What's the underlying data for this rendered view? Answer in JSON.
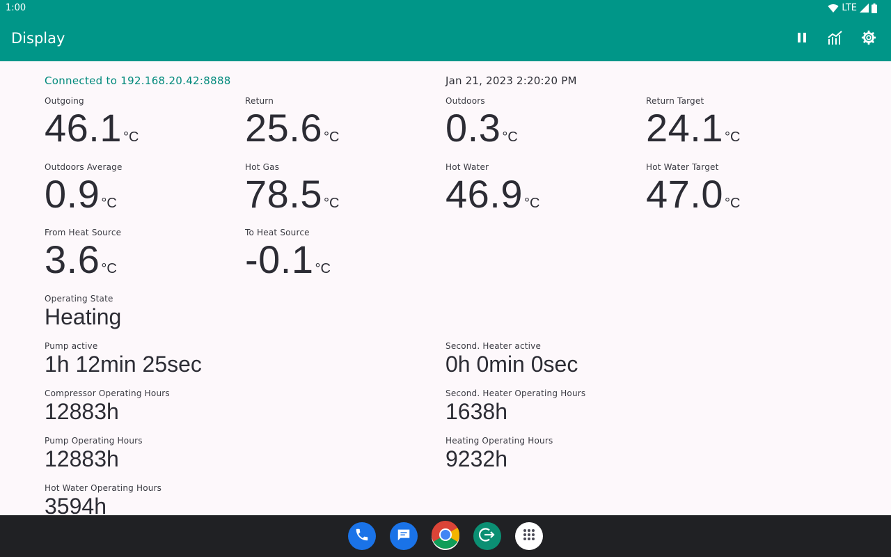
{
  "status_bar": {
    "time": "1:00",
    "network": "LTE"
  },
  "app_bar": {
    "title": "Display",
    "actions": {
      "pause": "pause-icon",
      "chart": "chart-icon",
      "settings": "gear-icon"
    }
  },
  "connection_status": "Connected to 192.168.20.42:8888",
  "timestamp": "Jan 21, 2023 2:20:20 PM",
  "temperatures": {
    "outgoing": {
      "label": "Outgoing",
      "value": "46.1",
      "unit": "°C"
    },
    "return": {
      "label": "Return",
      "value": "25.6",
      "unit": "°C"
    },
    "outdoors": {
      "label": "Outdoors",
      "value": "0.3",
      "unit": "°C"
    },
    "return_target": {
      "label": "Return Target",
      "value": "24.1",
      "unit": "°C"
    },
    "outdoors_average": {
      "label": "Outdoors Average",
      "value": "0.9",
      "unit": "°C"
    },
    "hot_gas": {
      "label": "Hot Gas",
      "value": "78.5",
      "unit": "°C"
    },
    "hot_water": {
      "label": "Hot Water",
      "value": "46.9",
      "unit": "°C"
    },
    "hot_water_target": {
      "label": "Hot Water Target",
      "value": "47.0",
      "unit": "°C"
    },
    "from_heat_source": {
      "label": "From Heat Source",
      "value": "3.6",
      "unit": "°C"
    },
    "to_heat_source": {
      "label": "To Heat Source",
      "value": "-0.1",
      "unit": "°C"
    }
  },
  "operating_state": {
    "label": "Operating State",
    "value": "Heating"
  },
  "pump_active": {
    "label": "Pump active",
    "value": "1h 12min 25sec"
  },
  "second_heater_active": {
    "label": "Second. Heater active",
    "value": "0h 0min 0sec"
  },
  "compressor_hours": {
    "label": "Compressor Operating Hours",
    "value": "12883h"
  },
  "second_heater_hours": {
    "label": "Second. Heater Operating Hours",
    "value": "1638h"
  },
  "pump_hours": {
    "label": "Pump Operating Hours",
    "value": "12883h"
  },
  "heating_hours": {
    "label": "Heating Operating Hours",
    "value": "9232h"
  },
  "hot_water_hours": {
    "label": "Hot Water Operating Hours",
    "value": "3594h"
  },
  "dock": [
    "phone-icon",
    "messages-icon",
    "chrome-icon",
    "exit-app-icon",
    "app-drawer-icon"
  ],
  "colors": {
    "primary": "#009688",
    "accent_text": "#00897b",
    "background": "#fdf8fb",
    "nav_bar": "#202124"
  }
}
